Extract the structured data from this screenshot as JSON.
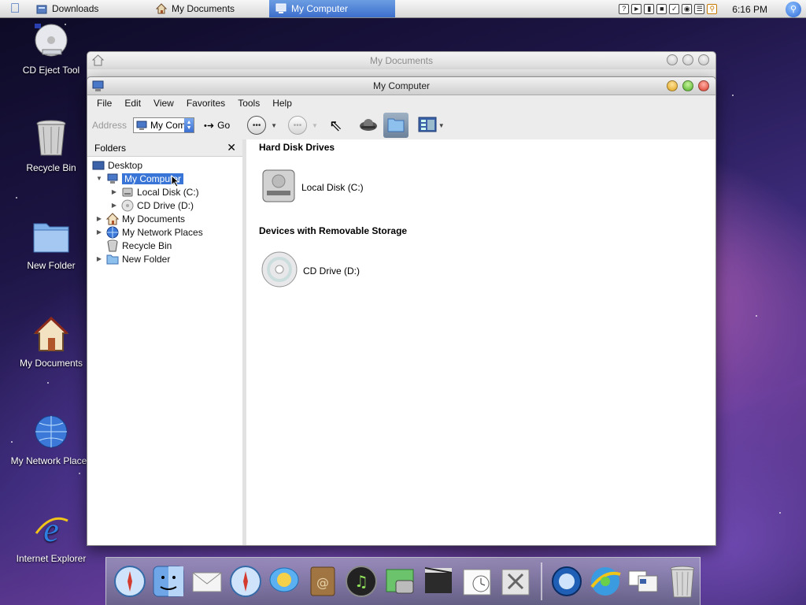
{
  "menubar": {
    "tasks": [
      {
        "label": "Downloads",
        "icon": "folder-icon"
      },
      {
        "label": "My Documents",
        "icon": "home-icon"
      },
      {
        "label": "My Computer",
        "icon": "computer-icon",
        "active": true
      }
    ],
    "tray_icons": [
      "help-icon",
      "speaker-icon",
      "battery-icon",
      "network-icon",
      "bluetooth-icon",
      "keyboard-icon",
      "flag-icon",
      "search-tray-icon"
    ],
    "clock": "6:16 PM"
  },
  "desktop_icons": [
    {
      "label": "CD Eject Tool",
      "icon": "cd-eject-icon"
    },
    {
      "label": "Recycle Bin",
      "icon": "recycle-bin-icon"
    },
    {
      "label": "New Folder",
      "icon": "folder-icon"
    },
    {
      "label": "My Documents",
      "icon": "home-icon"
    },
    {
      "label": "My Network Places",
      "icon": "globe-icon"
    },
    {
      "label": "Internet Explorer",
      "icon": "ie-icon"
    }
  ],
  "bg_window": {
    "title": "My Documents"
  },
  "main_window": {
    "title": "My Computer",
    "menu": [
      "File",
      "Edit",
      "View",
      "Favorites",
      "Tools",
      "Help"
    ],
    "toolbar": {
      "address_label": "Address",
      "address_value": "My Com",
      "go_label": "Go"
    },
    "folders_pane": {
      "title": "Folders",
      "tree": [
        {
          "label": "Desktop",
          "level": 0,
          "icon": "desktop-icon"
        },
        {
          "label": "My Computer",
          "level": 1,
          "icon": "computer-icon",
          "expanded": true,
          "selected": true
        },
        {
          "label": "Local Disk (C:)",
          "level": 2,
          "icon": "hard-disk-icon"
        },
        {
          "label": "CD Drive (D:)",
          "level": 2,
          "icon": "cd-drive-icon"
        },
        {
          "label": "My Documents",
          "level": 1,
          "icon": "home-icon"
        },
        {
          "label": "My Network Places",
          "level": 1,
          "icon": "globe-icon"
        },
        {
          "label": "Recycle Bin",
          "level": 1,
          "icon": "recycle-bin-icon"
        },
        {
          "label": "New Folder",
          "level": 1,
          "icon": "folder-icon"
        }
      ]
    },
    "content": {
      "sections": [
        {
          "title": "Hard Disk Drives",
          "items": [
            {
              "label": "Local Disk (C:)",
              "icon": "hard-disk-icon"
            }
          ]
        },
        {
          "title": "Devices with Removable Storage",
          "items": [
            {
              "label": "CD Drive (D:)",
              "icon": "cd-drive-icon"
            }
          ]
        }
      ]
    }
  },
  "dock": {
    "items": [
      "safari-icon",
      "finder-icon",
      "mail-icon",
      "safari-icon",
      "ichat-icon",
      "address-book-icon",
      "itunes-icon",
      "iphoto-icon",
      "imovie-icon",
      "ical-icon",
      "system-preferences-icon",
      "quicktime-icon",
      "internet-explorer-icon",
      "window-manager-icon",
      "trash-icon"
    ]
  },
  "colors": {
    "selection": "#3875d7",
    "active_task": "#3d6fcc"
  }
}
